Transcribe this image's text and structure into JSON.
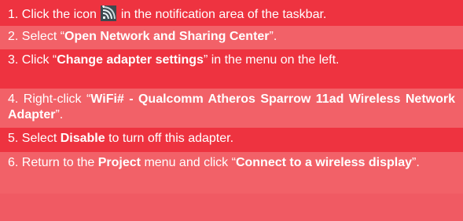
{
  "colors": {
    "row_dark": "#ee3340",
    "row_light": "#f26168",
    "text": "#ffffff"
  },
  "steps": [
    {
      "num": "1.",
      "pre": "Click the icon",
      "icon": "wireless-network-icon",
      "post": "in the notification area of the taskbar."
    },
    {
      "num": "2.",
      "pre": "Select “",
      "bold": "Open Network and Sharing Center",
      "post": "”."
    },
    {
      "num": "3.",
      "pre": "Click “",
      "bold": "Change adapter settings",
      "post": "” in the menu on the left."
    },
    {
      "num": "4.",
      "pre": "Right-click “",
      "bold": "WiFi# - Qualcomm Atheros Sparrow 11ad Wireless Network Adapter",
      "post": "”."
    },
    {
      "num": "5.",
      "pre": "Select",
      "bold": "Disable",
      "post": "to turn off this adapter."
    },
    {
      "num": "6.",
      "pre": "Return to the",
      "bold": "Project",
      "mid": "menu and click “",
      "bold2": "Connect to a wireless display",
      "post": "”."
    }
  ]
}
